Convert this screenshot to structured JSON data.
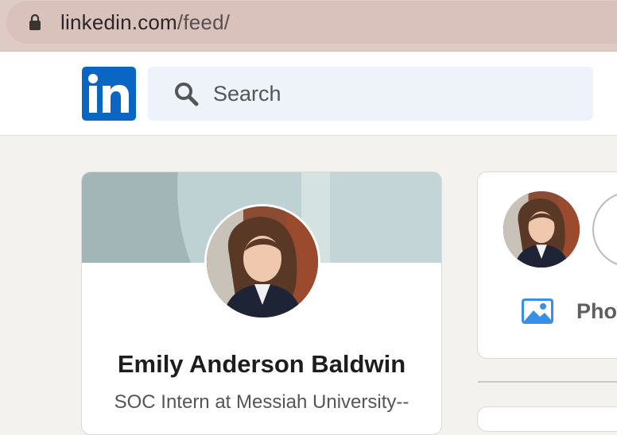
{
  "browser": {
    "url_host": "linkedin.com",
    "url_path": "/feed/",
    "lock_icon": "lock-icon"
  },
  "header": {
    "logo_text": "in",
    "search_placeholder": "Search",
    "search_icon": "search-icon"
  },
  "profile": {
    "name": "Emily Anderson Baldwin",
    "headline": "SOC Intern at Messiah University--"
  },
  "share_box": {
    "photo_label": "Pho",
    "photo_icon": "image-icon"
  },
  "colors": {
    "brand": "#0a66c2",
    "photo_icon": "#378fe9"
  }
}
